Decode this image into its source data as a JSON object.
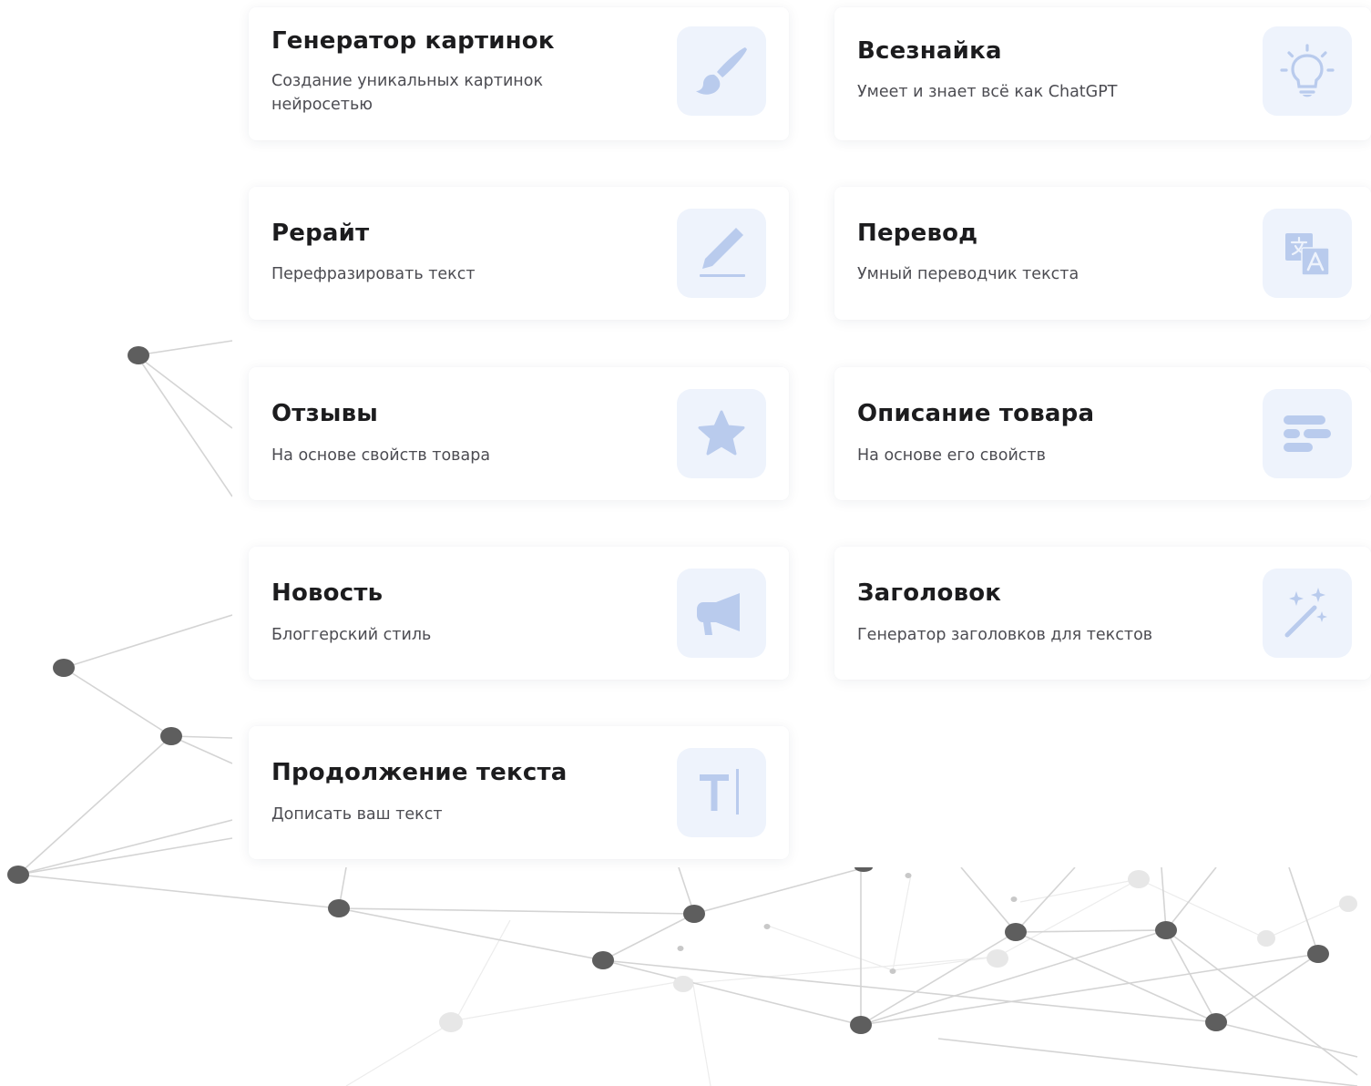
{
  "accent_color": "#b9cbed",
  "icon_box_color": "#eef3fc",
  "cards": [
    {
      "title": "Генератор картинок",
      "description": "Создание уникальных картинок нейросетью",
      "icon": "paint-brush-icon"
    },
    {
      "title": "Всезнайка",
      "description": "Умеет и знает всё как ChatGPT",
      "icon": "lightbulb-icon"
    },
    {
      "title": "Рерайт",
      "description": "Перефразировать текст",
      "icon": "pencil-icon"
    },
    {
      "title": "Перевод",
      "description": "Умный переводчик текста",
      "icon": "translate-icon"
    },
    {
      "title": "Отзывы",
      "description": "На основе свойств товара",
      "icon": "star-icon"
    },
    {
      "title": "Описание товара",
      "description": "На основе его свойств",
      "icon": "text-lines-icon"
    },
    {
      "title": "Новость",
      "description": "Блоггерский стиль",
      "icon": "megaphone-icon"
    },
    {
      "title": "Заголовок",
      "description": "Генератор заголовков для текстов",
      "icon": "magic-wand-icon"
    },
    {
      "title": "Продолжение текста",
      "description": "Дописать ваш текст",
      "icon": "text-cursor-icon"
    }
  ]
}
